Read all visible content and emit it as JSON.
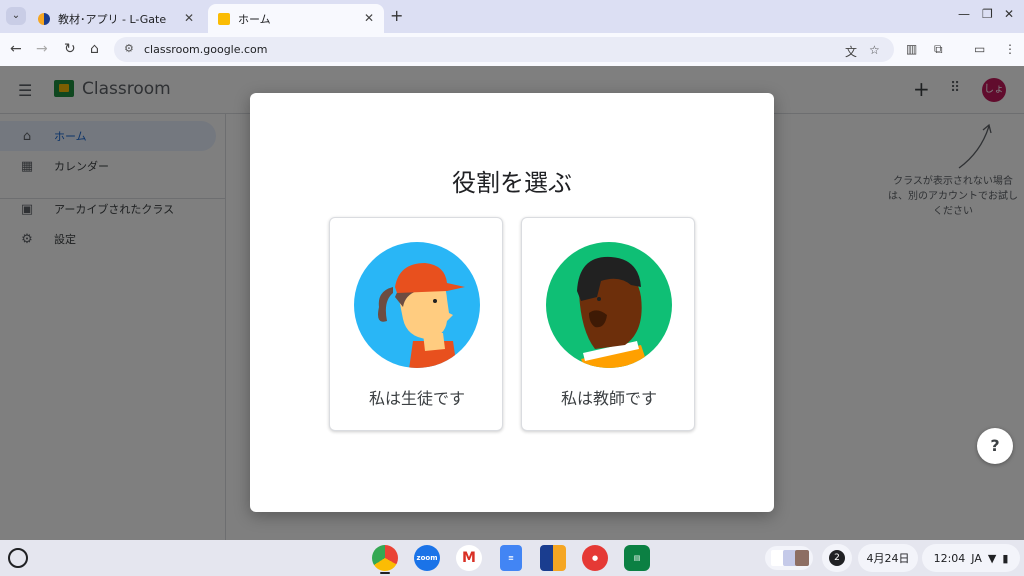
{
  "browser": {
    "tabs": [
      {
        "title": "教材･アプリ - L-Gate",
        "close": "✕"
      },
      {
        "title": "ホーム",
        "close": "✕"
      }
    ],
    "new_tab": "+",
    "url": "classroom.google.com"
  },
  "app": {
    "title": "Classroom",
    "avatar_initials": "しょ"
  },
  "sidebar": {
    "items": [
      {
        "label": "ホーム",
        "icon": "home-icon"
      },
      {
        "label": "カレンダー",
        "icon": "calendar-icon"
      },
      {
        "label": "アーカイブされたクラス",
        "icon": "archive-icon"
      },
      {
        "label": "設定",
        "icon": "gear-icon"
      }
    ]
  },
  "hint": {
    "text": "クラスが表示されない場合は、別のアカウントでお試しください"
  },
  "dialog": {
    "title": "役割を選ぶ",
    "student_label": "私は生徒です",
    "teacher_label": "私は教師です"
  },
  "help": {
    "symbol": "?"
  },
  "shelf": {
    "apps": [
      "chrome-icon",
      "zoom-icon",
      "gmail-icon",
      "docs-icon",
      "l-gate-icon",
      "paint-icon",
      "classroom-icon"
    ],
    "zoom_text": "zoom",
    "notification_count": "2",
    "date": "4月24日",
    "time": "12:04",
    "ime": "JA"
  },
  "colors": {
    "student_bg": "#29b6f6",
    "teacher_bg": "#0fbf75",
    "avatar": "#c2185b"
  }
}
